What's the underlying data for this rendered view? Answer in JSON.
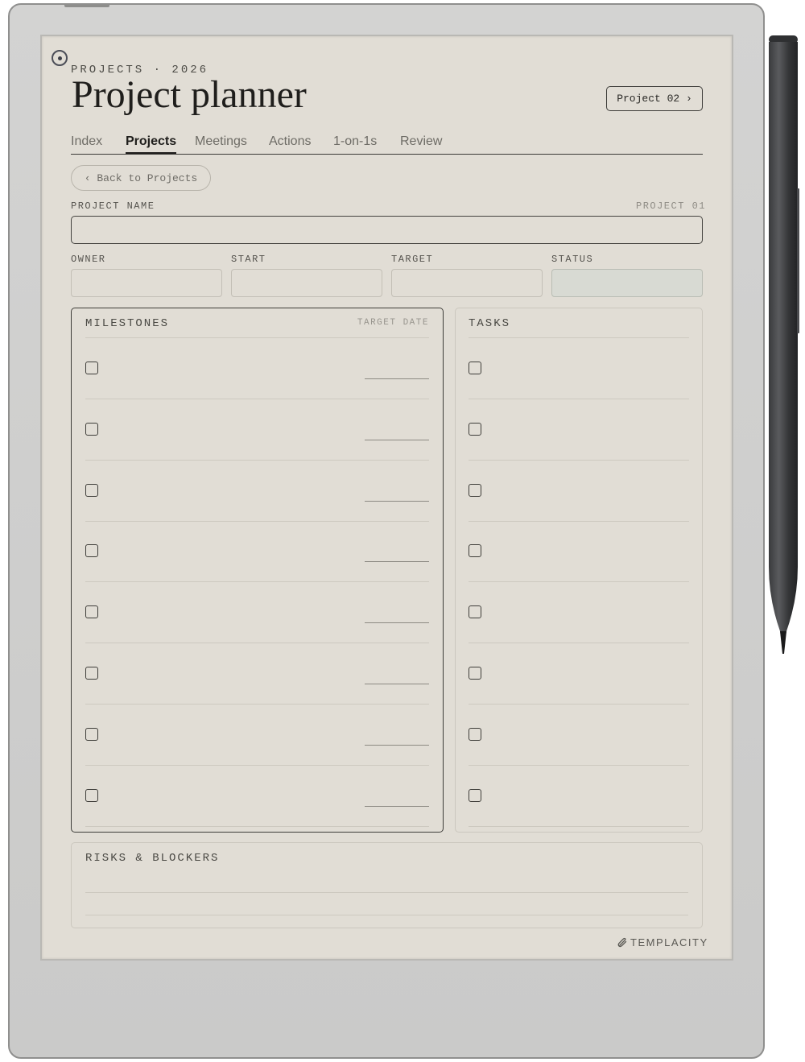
{
  "header": {
    "eyebrow": "PROJECTS · 2026",
    "title": "Project planner",
    "next_button": "Project 02 ›"
  },
  "tabs": [
    {
      "label": "Index",
      "active": false
    },
    {
      "label": "Projects",
      "active": true
    },
    {
      "label": "Meetings",
      "active": false
    },
    {
      "label": "Actions",
      "active": false
    },
    {
      "label": "1-on-1s",
      "active": false
    },
    {
      "label": "Review",
      "active": false
    }
  ],
  "back_button": "‹ Back to Projects",
  "project": {
    "name_label": "PROJECT NAME",
    "page_id": "PROJECT 01",
    "owner_label": "OWNER",
    "start_label": "START",
    "target_label": "TARGET",
    "status_label": "STATUS"
  },
  "milestones": {
    "heading": "MILESTONES",
    "subheading": "TARGET DATE",
    "row_count": 8
  },
  "tasks": {
    "heading": "TASKS",
    "row_count": 8
  },
  "risks": {
    "heading": "RISKS & BLOCKERS"
  },
  "brand": {
    "name": "TEMPLACITY"
  },
  "colors": {
    "paper": "#e1ddd5",
    "ink": "#1f1e1c",
    "status_fill": "#d8dad3",
    "device": "#cacac9"
  }
}
